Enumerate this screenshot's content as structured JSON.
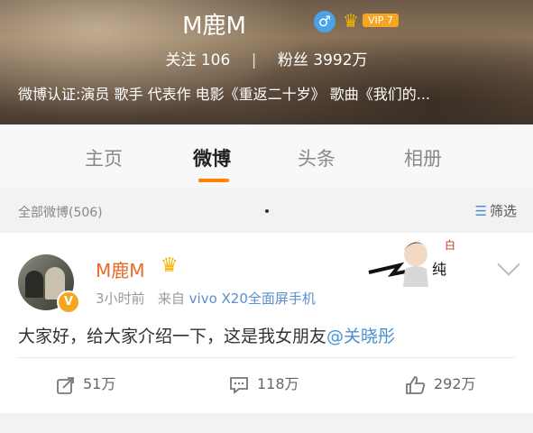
{
  "header": {
    "name": "M鹿M",
    "gender_icon": "♂",
    "vip_label": "VIP 7",
    "following_label": "关注",
    "following_count": "106",
    "fans_label": "粉丝",
    "fans_count": "3992万",
    "bio": "微博认证:演员 歌手 代表作 电影《重返二十岁》 歌曲《我们的..."
  },
  "tabs": [
    {
      "label": "主页"
    },
    {
      "label": "微博"
    },
    {
      "label": "头条"
    },
    {
      "label": "相册"
    }
  ],
  "filter_bar": {
    "all_posts": "全部微博(506)",
    "filter_label": "筛选"
  },
  "post": {
    "author": "M鹿M",
    "time": "3小时前",
    "from_label": "来自",
    "device": "vivo X20全面屏手机",
    "text": "大家好，给大家介绍一下，这是我女朋友",
    "mention": "@关晓彤",
    "actions": {
      "repost": "51万",
      "comment": "118万",
      "like": "292万"
    }
  },
  "colors": {
    "accent_orange": "#ff8200",
    "link_blue": "#4a8fd4",
    "author_orange": "#e8692a"
  }
}
